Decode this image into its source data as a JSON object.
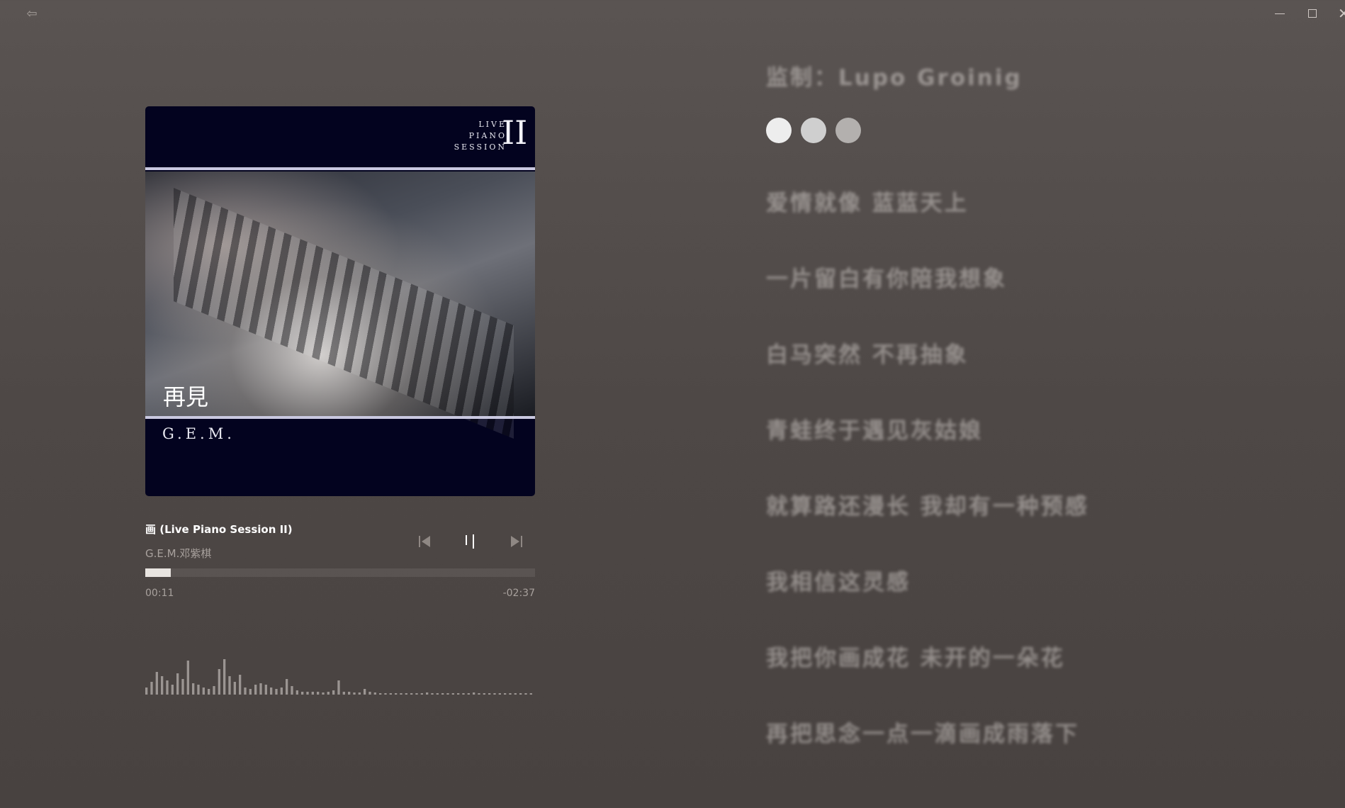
{
  "window": {
    "back_icon": "back-arrow-icon",
    "minimize_icon": "minimize-icon",
    "maximize_icon": "maximize-icon",
    "close_icon": "close-icon"
  },
  "album": {
    "live_label_line1": "LIVE",
    "live_label_line2": "PIANO",
    "live_label_line3": "SESSION",
    "volume_numeral": "II",
    "cover_title": "再見",
    "cover_artist": "G.E.M."
  },
  "track": {
    "title": "画 (Live Piano Session II)",
    "artist": "G.E.M.邓紫棋",
    "elapsed": "00:11",
    "remaining": "-02:37",
    "progress_fraction": 0.065
  },
  "controls": {
    "prev_icon": "skip-previous-icon",
    "pause_icon": "pause-icon",
    "next_icon": "skip-next-icon"
  },
  "visualizer": {
    "levels": [
      10,
      18,
      32,
      26,
      20,
      14,
      30,
      22,
      48,
      16,
      14,
      10,
      8,
      12,
      36,
      50,
      26,
      18,
      28,
      10,
      8,
      14,
      16,
      14,
      10,
      8,
      10,
      22,
      12,
      6,
      4,
      4,
      4,
      4,
      3,
      4,
      6,
      20,
      4,
      4,
      3,
      3,
      8,
      4,
      3,
      2,
      2,
      2,
      2,
      2,
      2,
      2,
      2,
      2,
      3,
      2,
      2,
      2,
      2,
      2,
      2,
      2,
      2,
      3,
      2,
      2,
      2,
      2,
      2,
      2,
      2,
      2,
      2,
      2,
      2
    ]
  },
  "lyrics": {
    "lines": [
      "监制：Lupo Groinig",
      "爱情就像 蓝蓝天上",
      "一片留白有你陪我想象",
      "白马突然 不再抽象",
      "青蛙终于遇见灰姑娘",
      "就算路还漫长 我却有一种预感",
      "我相信这灵感",
      "我把你画成花 未开的一朵花",
      "再把思念一点一滴画成雨落下"
    ],
    "dots_colors": [
      "#ededed",
      "#cfcfcf",
      "#b3b0ae"
    ]
  }
}
